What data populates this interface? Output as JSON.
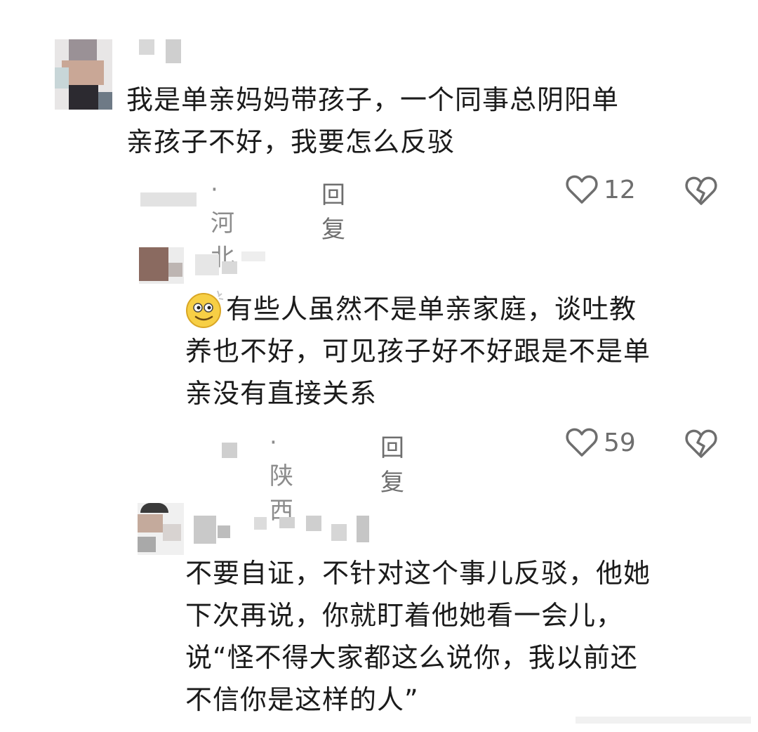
{
  "comments": [
    {
      "text": "我是单亲妈妈带孩子，一个同事总阴阳单\n亲孩子不好，我要怎么反驳",
      "location": "· 河北",
      "reply_label": "回复",
      "likes": "12",
      "like_icon": "heart-outline-icon",
      "dislike_icon": "broken-heart-icon"
    },
    {
      "text": "有些人虽然不是单亲家庭，谈吐教\n养也不好，可见孩子好不好跟是不是单\n亲没有直接关系",
      "emoji": "smiley-emoji-icon",
      "location": "· 陕西",
      "reply_label": "回复",
      "likes": "59",
      "like_icon": "heart-outline-icon",
      "dislike_icon": "broken-heart-icon"
    },
    {
      "text": "不要自证，不针对这个事儿反驳，他她\n下次再说，你就盯着他她看一会儿，\n说“怪不得大家都这么说你，我以前还\n不信你是这样的人”"
    }
  ],
  "colors": {
    "text": "#1b1b1b",
    "meta": "#8c8c8c",
    "icon": "#6e6e6e"
  }
}
